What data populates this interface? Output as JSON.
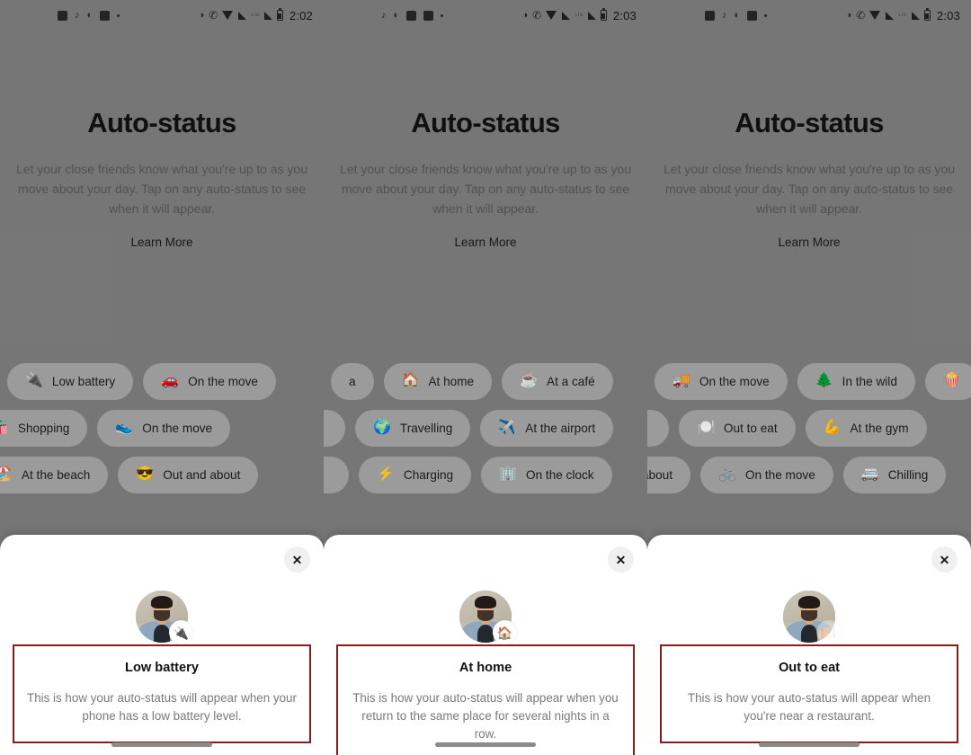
{
  "panels": [
    {
      "status_bar": {
        "time": "2:02",
        "left_icons": [
          "photo-icon",
          "music-note-icon",
          "camera-icon",
          "calendar-icon",
          "more-dot-icon"
        ],
        "right_icons": [
          "do-not-disturb-icon",
          "volte-icon",
          "wifi-icon",
          "signal-icon",
          "lte-label",
          "signal2-icon",
          "battery-icon"
        ],
        "lte_label": "LTE"
      },
      "hero": {
        "title": "Auto-status",
        "subtitle": "Let your close friends know what you're up to as you move about your day. Tap on any auto-status to see when it will appear.",
        "learn_more": "Learn More"
      },
      "chip_rows": [
        [
          {
            "emoji": "🔌",
            "label": "Low battery",
            "icon": "plug-icon"
          },
          {
            "emoji": "🚗",
            "label": "On the move",
            "icon": "car-icon"
          }
        ],
        [
          {
            "emoji": "🛍️",
            "label": "Shopping",
            "icon": "shopping-bags-icon"
          },
          {
            "emoji": "👟",
            "label": "On the move",
            "icon": "sneaker-icon"
          }
        ],
        [
          {
            "emoji": "🏖️",
            "label": "At the beach",
            "icon": "beach-icon"
          },
          {
            "emoji": "😎",
            "label": "Out and about",
            "icon": "sunglasses-icon"
          }
        ]
      ],
      "sheet": {
        "close_label": "✕",
        "badge_emoji": "🔌",
        "badge_icon": "plug-icon",
        "badge_faded": false,
        "title": "Low battery",
        "description": "This is how your auto-status will appear when your phone has a low battery level."
      }
    },
    {
      "status_bar": {
        "time": "2:03",
        "left_icons": [
          "music-note-icon",
          "camera-icon",
          "calendar-icon",
          "photo-icon",
          "more-dot-icon"
        ],
        "right_icons": [
          "do-not-disturb-icon",
          "volte-icon",
          "wifi-icon",
          "signal-icon",
          "lte-label",
          "signal2-icon",
          "battery-icon"
        ],
        "lte_label": "LTE"
      },
      "hero": {
        "title": "Auto-status",
        "subtitle": "Let your close friends know what you're up to as you move about your day. Tap on any auto-status to see when it will appear.",
        "learn_more": "Learn More"
      },
      "chip_rows": [
        [
          {
            "emoji": "",
            "label": "a",
            "icon": "partial-chip"
          },
          {
            "emoji": "🏠",
            "label": "At home",
            "icon": "house-icon"
          },
          {
            "emoji": "☕",
            "label": "At a café",
            "icon": "coffee-icon"
          }
        ],
        [
          {
            "emoji": "",
            "label": "",
            "icon": "partial-chip"
          },
          {
            "emoji": "🌍",
            "label": "Travelling",
            "icon": "globe-icon"
          },
          {
            "emoji": "✈️",
            "label": "At the airport",
            "icon": "airplane-icon"
          }
        ],
        [
          {
            "emoji": "",
            "label": "",
            "icon": "partial-chip"
          },
          {
            "emoji": "⚡",
            "label": "Charging",
            "icon": "lightning-icon"
          },
          {
            "emoji": "🏢",
            "label": "On the clock",
            "icon": "office-building-icon"
          }
        ]
      ],
      "sheet": {
        "close_label": "✕",
        "badge_emoji": "🏠",
        "badge_icon": "house-icon",
        "badge_faded": false,
        "title": "At home",
        "description": "This is how your auto-status will appear when you return to the same place for several nights in a row."
      }
    },
    {
      "status_bar": {
        "time": "2:03",
        "left_icons": [
          "photo-icon",
          "music-note-icon",
          "camera-icon",
          "calendar-icon",
          "more-dot-icon"
        ],
        "right_icons": [
          "do-not-disturb-icon",
          "volte-icon",
          "wifi-icon",
          "signal-icon",
          "lte-label",
          "signal2-icon",
          "battery-icon"
        ],
        "lte_label": "LTE"
      },
      "hero": {
        "title": "Auto-status",
        "subtitle": "Let your close friends know what you're up to as you move about your day. Tap on any auto-status to see when it will appear.",
        "learn_more": "Learn More"
      },
      "chip_rows": [
        [
          {
            "emoji": "🚚",
            "label": "On the move",
            "icon": "truck-icon"
          },
          {
            "emoji": "🌲",
            "label": "In the wild",
            "icon": "evergreen-tree-icon"
          },
          {
            "emoji": "🍿",
            "label": "",
            "icon": "popcorn-icon"
          }
        ],
        [
          {
            "emoji": "",
            "label": "",
            "icon": "partial-chip"
          },
          {
            "emoji": "🍽️",
            "label": "Out to eat",
            "icon": "cutlery-icon"
          },
          {
            "emoji": "💪",
            "label": "At the gym",
            "icon": "flexed-biceps-icon"
          }
        ],
        [
          {
            "emoji": "",
            "label": "about",
            "icon": "partial-chip"
          },
          {
            "emoji": "🚲",
            "label": "On the move",
            "icon": "bicycle-icon"
          },
          {
            "emoji": "🚐",
            "label": "Chilling",
            "icon": "minibus-icon"
          }
        ]
      ],
      "sheet": {
        "close_label": "✕",
        "badge_emoji": "🍽️",
        "badge_icon": "cutlery-icon",
        "badge_faded": true,
        "title": "Out to eat",
        "description": "This is how your auto-status will appear when you're near a restaurant."
      }
    }
  ],
  "colors": {
    "highlight_border": "#8e1b1b",
    "scrim": "#7e7e7e",
    "sheet_bg": "#ffffff",
    "title": "#121212",
    "muted_text": "#7a7a7a"
  }
}
